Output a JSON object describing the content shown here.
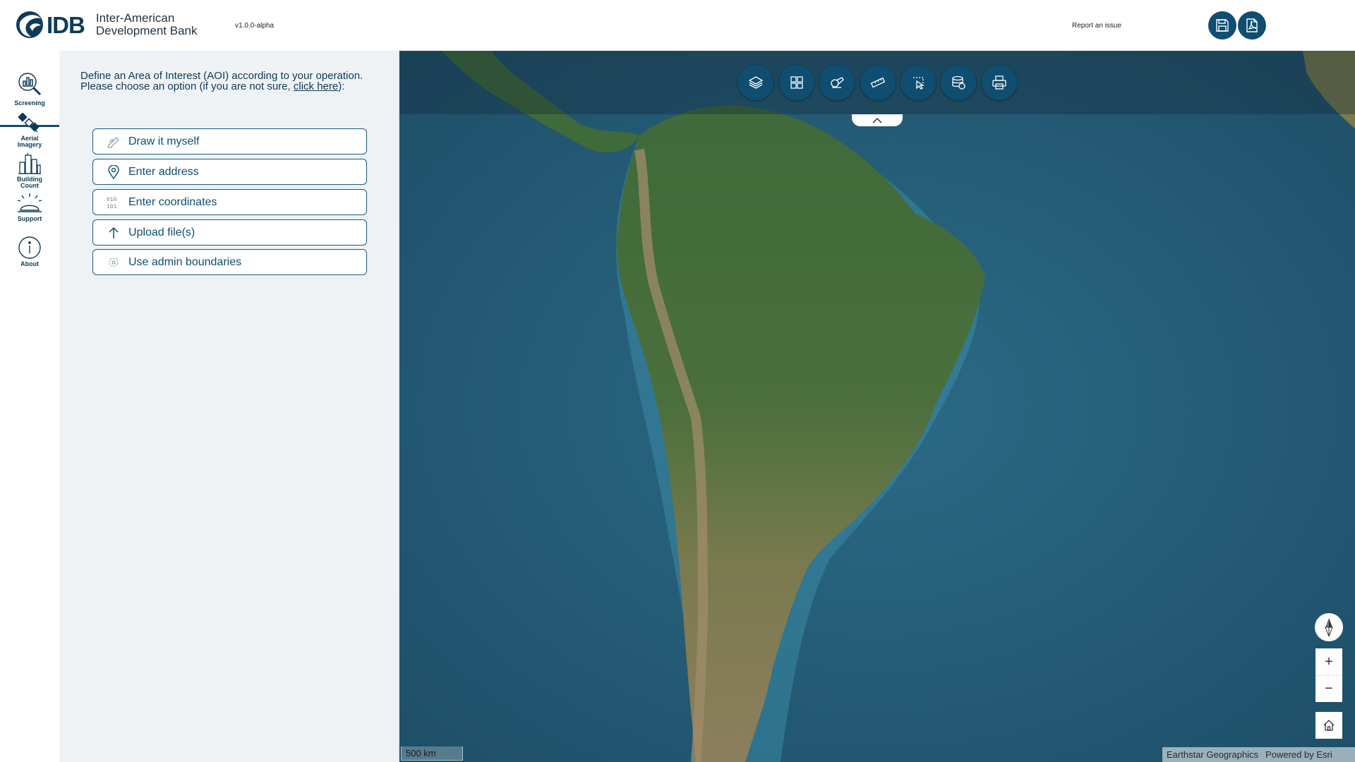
{
  "header": {
    "logo_short": "IDB",
    "logo_name_line1": "Inter-American",
    "logo_name_line2": "Development Bank",
    "version": "v1.0.0-alpha",
    "report_link": "Report an issue",
    "buttons": [
      {
        "name": "save-button",
        "icon": "floppy-disk-icon"
      },
      {
        "name": "export-pdf-button",
        "icon": "pdf-file-icon"
      }
    ]
  },
  "rail": {
    "items": [
      {
        "label": "Screening",
        "icon": "magnifier-chart-icon",
        "active": true
      },
      {
        "label_line1": "Aerial",
        "label_line2": "Imagery",
        "icon": "satellite-icon"
      },
      {
        "label_line1": "Building",
        "label_line2": "Count",
        "icon": "buildings-icon"
      },
      {
        "label": "Support",
        "icon": "service-bell-icon"
      },
      {
        "label": "About",
        "icon": "info-circle-icon"
      }
    ]
  },
  "panel": {
    "intro_line1": "Define an Area of Interest (AOI) according to your operation.",
    "intro_line2_prefix": "Please choose an option (if you are not sure, ",
    "intro_link": "click here",
    "intro_line2_suffix": "):",
    "options": [
      {
        "label": "Draw it myself",
        "icon": "pencil-draw-icon"
      },
      {
        "label": "Enter address",
        "icon": "map-pin-icon"
      },
      {
        "label": "Enter coordinates",
        "icon": "binary-digits-icon"
      },
      {
        "label": "Upload file(s)",
        "icon": "arrow-up-icon"
      },
      {
        "label": "Use admin boundaries",
        "icon": "boundary-polygon-icon"
      }
    ]
  },
  "map": {
    "tools": [
      {
        "name": "layers-tool",
        "icon": "layers-icon"
      },
      {
        "name": "basemap-gallery-tool",
        "icon": "grid-icon"
      },
      {
        "name": "sketch-tool",
        "icon": "draw-shapes-icon"
      },
      {
        "name": "measure-tool",
        "icon": "ruler-icon"
      },
      {
        "name": "select-tool",
        "icon": "select-features-icon"
      },
      {
        "name": "data-tool",
        "icon": "database-icon"
      },
      {
        "name": "print-tool",
        "icon": "printer-icon"
      }
    ],
    "zoom_in": "+",
    "zoom_out": "−",
    "scale_label": "500 km",
    "attribution_source": "Earthstar Geographics",
    "attribution_powered": "Powered by Esri"
  },
  "colors": {
    "brand_navy": "#0f4e70",
    "panel_bg": "#eff2f5",
    "ocean": "#245a75"
  }
}
